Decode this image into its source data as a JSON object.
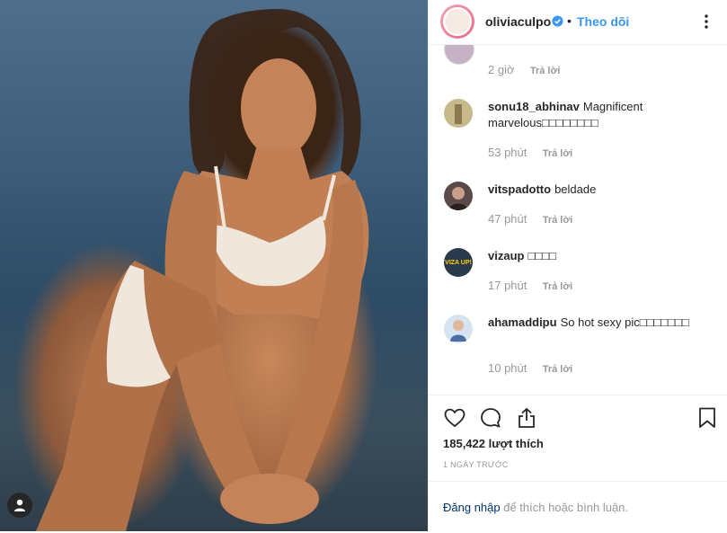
{
  "post": {
    "username": "oliviaculpo",
    "follow_label": "Theo dõi",
    "dot": "•",
    "likes": "185,422 lượt thích",
    "date": "1 NGÀY TRƯỚC",
    "login_link": "Đăng nhập",
    "login_rest": " để thích hoặc bình luận."
  },
  "reply_label": "Trả lời",
  "previous_comment": {
    "time": "2 giờ",
    "reply": "Trả lời"
  },
  "comments": [
    {
      "user": "sonu18_abhinav",
      "text": "Magnificent marvelous□□□□□□□□",
      "time": "53 phút",
      "reply": "Trả lời"
    },
    {
      "user": "vitspadotto",
      "text": "beldade",
      "time": "47 phút",
      "reply": "Trả lời"
    },
    {
      "user": "vizaup",
      "text": "□□□□",
      "time": "17 phút",
      "reply": "Trả lời",
      "avatar_text": "VIZA UP!"
    },
    {
      "user": "ahamaddipu",
      "text": "So hot sexy pic□□□□□□□",
      "time": "10 phút",
      "reply": "Trả lời"
    }
  ],
  "colors": {
    "link_blue": "#3897f0",
    "verified_blue": "#3897f0",
    "muted": "#999999",
    "text": "#262626"
  },
  "icons": {
    "like": "heart-icon",
    "comment": "comment-bubble-icon",
    "share": "share-upload-icon",
    "save": "bookmark-icon",
    "more": "more-options-icon",
    "verified": "verified-badge-icon",
    "user": "user-tag-icon"
  }
}
